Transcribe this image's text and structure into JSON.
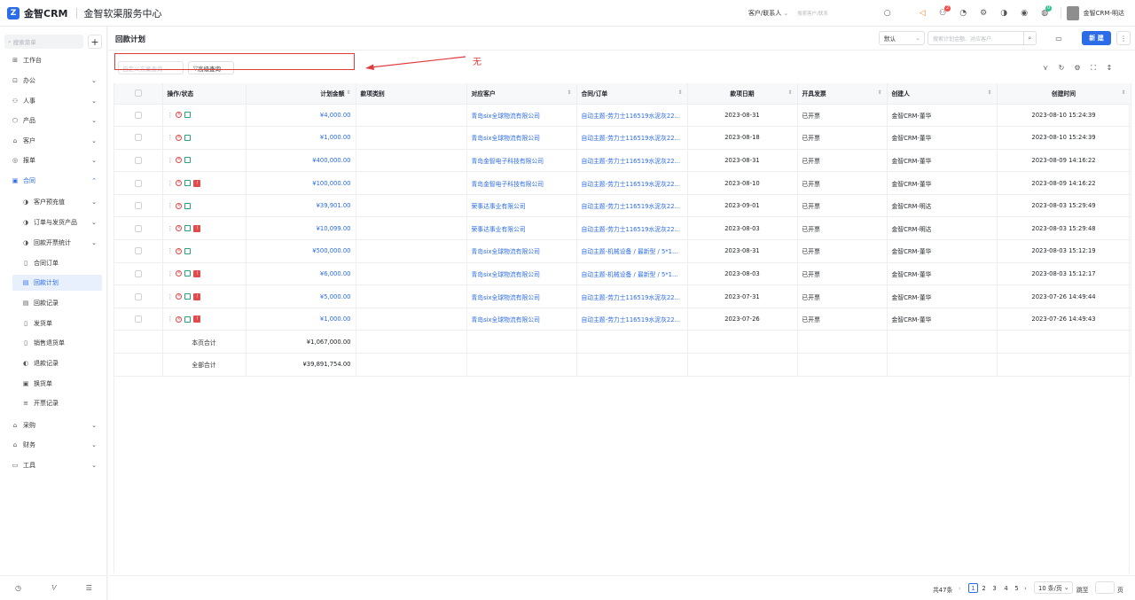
{
  "topbar": {
    "logo_mark": "Z",
    "brand": "金智CRM",
    "app_name": "金智软渠服务中心",
    "customer_select": "客户/联系人",
    "search_placeholder": "搜索客户/联系",
    "notification_count": "2",
    "update_badge": "0",
    "user_name": "金智CRM-明达"
  },
  "sidebar": {
    "search_placeholder": "搜索菜单",
    "add_label": "+",
    "items": [
      {
        "label": "工作台",
        "icon": "⊞"
      },
      {
        "label": "办公",
        "icon": "⊡"
      },
      {
        "label": "人事",
        "icon": "⚇"
      },
      {
        "label": "产品",
        "icon": "⬡"
      },
      {
        "label": "客户",
        "icon": "⌂"
      },
      {
        "label": "报单",
        "icon": "◎"
      },
      {
        "label": "合同",
        "icon": "▣"
      },
      {
        "label": "客户预充值",
        "icon": "◑"
      },
      {
        "label": "订单与发货产品",
        "icon": "◑"
      },
      {
        "label": "回款开票统计",
        "icon": "◑"
      },
      {
        "label": "合同订单",
        "icon": "▯"
      },
      {
        "label": "回款计划",
        "icon": "▤"
      },
      {
        "label": "回款记录",
        "icon": "▤"
      },
      {
        "label": "发货单",
        "icon": "▯"
      },
      {
        "label": "销售退货单",
        "icon": "▯"
      },
      {
        "label": "退款记录",
        "icon": "◐"
      },
      {
        "label": "换货单",
        "icon": "▣"
      },
      {
        "label": "开票记录",
        "icon": "≡"
      },
      {
        "label": "采购",
        "icon": "⌂"
      },
      {
        "label": "财务",
        "icon": "⌂"
      },
      {
        "label": "工具",
        "icon": "▭"
      }
    ],
    "bottom_icons": [
      "◷",
      "⅟",
      "☰"
    ]
  },
  "page": {
    "title": "回款计划",
    "view_select": "默认",
    "search_placeholder": "搜索计划金额、对应客户",
    "new_button": "新 建",
    "custom_filter_placeholder": "自定义方案查询",
    "advanced_query": "高级查询",
    "annotation": "无"
  },
  "table": {
    "headers": {
      "ops": "操作/状态",
      "amount": "计划金额",
      "type": "款项类别",
      "customer": "对应客户",
      "contract": "合同/订单",
      "date": "款项日期",
      "invoice": "开具发票",
      "creator": "创建人",
      "created": "创建时间"
    },
    "rows": [
      {
        "amount": "¥4,000.00",
        "type": "",
        "customer": "青岛six全球物流有限公司",
        "contract": "自动主题-劳力士116519水泥灰22...",
        "date": "2023-08-31",
        "invoice": "已开票",
        "creator": "金智CRM-董华",
        "created": "2023-08-10 15:24:39",
        "warn": false
      },
      {
        "amount": "¥1,000.00",
        "type": "",
        "customer": "青岛six全球物流有限公司",
        "contract": "自动主题-劳力士116519水泥灰22...",
        "date": "2023-08-18",
        "invoice": "已开票",
        "creator": "金智CRM-董华",
        "created": "2023-08-10 15:24:39",
        "warn": false
      },
      {
        "amount": "¥400,000.00",
        "type": "",
        "customer": "青岛金智电子科技有限公司",
        "contract": "自动主题-劳力士116519水泥灰22...",
        "date": "2023-08-31",
        "invoice": "已开票",
        "creator": "金智CRM-董华",
        "created": "2023-08-09 14:16:22",
        "warn": false
      },
      {
        "amount": "¥100,000.00",
        "type": "",
        "customer": "青岛金智电子科技有限公司",
        "contract": "自动主题-劳力士116519水泥灰22...",
        "date": "2023-08-10",
        "invoice": "已开票",
        "creator": "金智CRM-董华",
        "created": "2023-08-09 14:16:22",
        "warn": true
      },
      {
        "amount": "¥39,901.00",
        "type": "",
        "customer": "荣事达事业有限公司",
        "contract": "自动主题-劳力士116519水泥灰22...",
        "date": "2023-09-01",
        "invoice": "已开票",
        "creator": "金智CRM-明达",
        "created": "2023-08-03 15:29:49",
        "warn": false
      },
      {
        "amount": "¥10,099.00",
        "type": "",
        "customer": "荣事达事业有限公司",
        "contract": "自动主题-劳力士116519水泥灰22...",
        "date": "2023-08-03",
        "invoice": "已开票",
        "creator": "金智CRM-明达",
        "created": "2023-08-03 15:29:48",
        "warn": true
      },
      {
        "amount": "¥500,000.00",
        "type": "",
        "customer": "青岛six全球物流有限公司",
        "contract": "自动主题-机械设备 / 最新型 / 5*1...",
        "date": "2023-08-31",
        "invoice": "已开票",
        "creator": "金智CRM-董华",
        "created": "2023-08-03 15:12:19",
        "warn": false
      },
      {
        "amount": "¥6,000.00",
        "type": "",
        "customer": "青岛six全球物流有限公司",
        "contract": "自动主题-机械设备 / 最新型 / 5*1...",
        "date": "2023-08-03",
        "invoice": "已开票",
        "creator": "金智CRM-董华",
        "created": "2023-08-03 15:12:17",
        "warn": true
      },
      {
        "amount": "¥5,000.00",
        "type": "",
        "customer": "青岛six全球物流有限公司",
        "contract": "自动主题-劳力士116519水泥灰22...",
        "date": "2023-07-31",
        "invoice": "已开票",
        "creator": "金智CRM-董华",
        "created": "2023-07-26 14:49:44",
        "warn": true
      },
      {
        "amount": "¥1,000.00",
        "type": "",
        "customer": "青岛six全球物流有限公司",
        "contract": "自动主题-劳力士116519水泥灰22...",
        "date": "2023-07-26",
        "invoice": "已开票",
        "creator": "金智CRM-董华",
        "created": "2023-07-26 14:49:43",
        "warn": true
      }
    ],
    "page_total_label": "本页合计",
    "page_total_value": "¥1,067,000.00",
    "all_total_label": "全部合计",
    "all_total_value": "¥39,891,754.00"
  },
  "pager": {
    "total": "共47条",
    "pages": [
      "1",
      "2",
      "3",
      "4",
      "5"
    ],
    "current": "1",
    "page_size": "10 条/页",
    "jump_label": "跳至",
    "page_label": "页"
  },
  "colors": {
    "primary": "#2c6ce6",
    "danger": "#e14b4b",
    "success": "#26a37a",
    "annotation": "#e03c3c"
  }
}
